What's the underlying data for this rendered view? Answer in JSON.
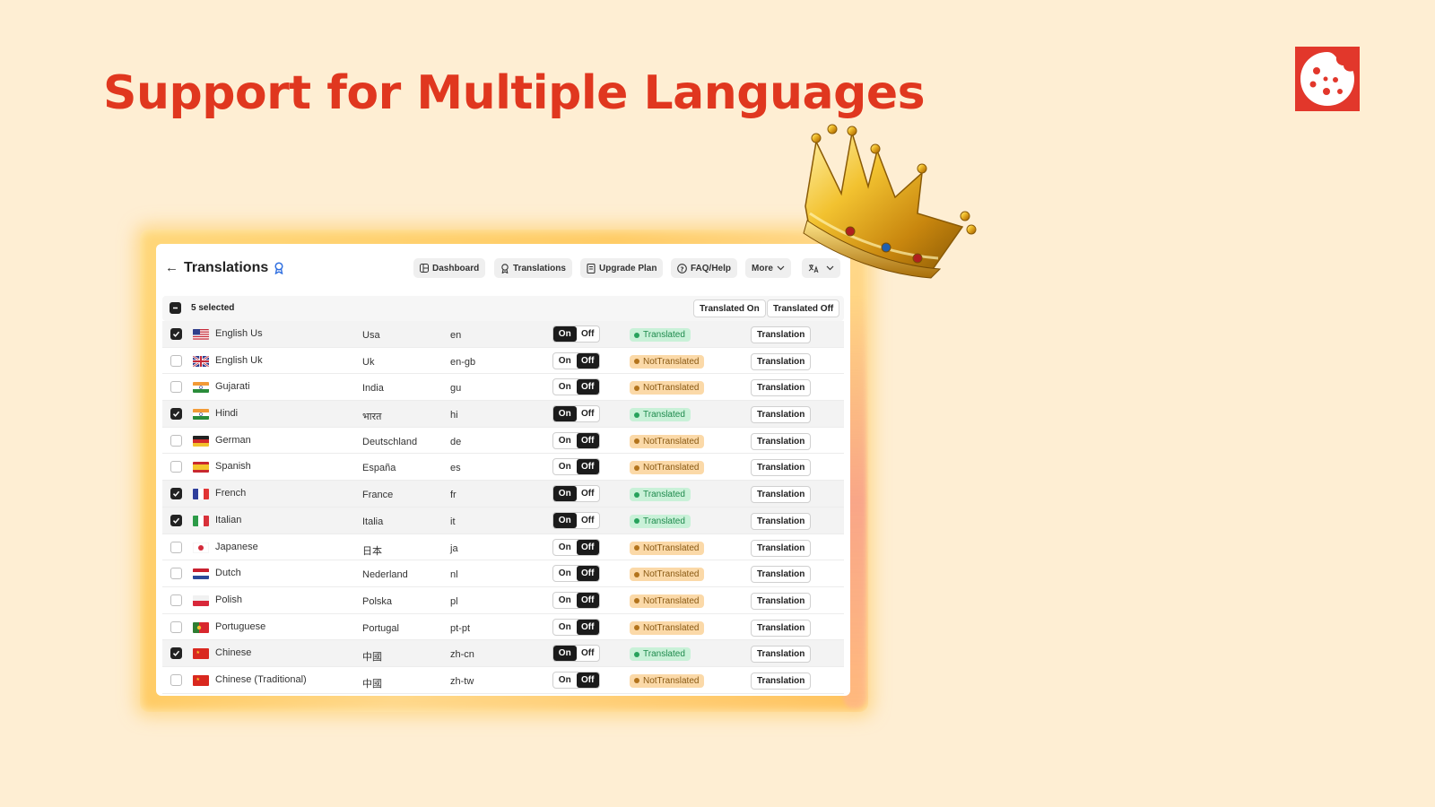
{
  "headline": "Support for Multiple Languages",
  "brand_logo": "cookie-logo",
  "decoration": "gold-crown",
  "header": {
    "back_icon": "arrow-left-icon",
    "title": "Translations",
    "title_icon": "award-badge-icon"
  },
  "nav": [
    {
      "label": "Dashboard",
      "icon": "layout-icon"
    },
    {
      "label": "Translations",
      "icon": "award-icon"
    },
    {
      "label": "Upgrade Plan",
      "icon": "receipt-icon"
    },
    {
      "label": "FAQ/Help",
      "icon": "help-circle-icon"
    },
    {
      "label": "More",
      "icon": "chevron-down-icon"
    }
  ],
  "language_switcher_icon": "translate-icon",
  "selection": {
    "text": "5 selected",
    "bulk_on": "Translated On",
    "bulk_off": "Translated Off"
  },
  "colors": {
    "background": "#feeed3",
    "headline": "#e0371f",
    "logo": "#e2372b",
    "translated_bg": "#c9f1d8",
    "not_translated_bg": "#fbd9a8"
  },
  "toggle_labels": {
    "on": "On",
    "off": "Off"
  },
  "action_label": "Translation",
  "rows": [
    {
      "name": "English Us",
      "country": "Usa",
      "code": "en",
      "flag": "us",
      "checked": true,
      "toggle": "On",
      "status": "Translated"
    },
    {
      "name": "English Uk",
      "country": "Uk",
      "code": "en-gb",
      "flag": "uk",
      "checked": false,
      "toggle": "Off",
      "status": "NotTranslated"
    },
    {
      "name": "Gujarati",
      "country": "India",
      "code": "gu",
      "flag": "in",
      "checked": false,
      "toggle": "Off",
      "status": "NotTranslated"
    },
    {
      "name": "Hindi",
      "country": "भारत",
      "code": "hi",
      "flag": "in",
      "checked": true,
      "toggle": "On",
      "status": "Translated"
    },
    {
      "name": "German",
      "country": "Deutschland",
      "code": "de",
      "flag": "de",
      "checked": false,
      "toggle": "Off",
      "status": "NotTranslated"
    },
    {
      "name": "Spanish",
      "country": "España",
      "code": "es",
      "flag": "es",
      "checked": false,
      "toggle": "Off",
      "status": "NotTranslated"
    },
    {
      "name": "French",
      "country": "France",
      "code": "fr",
      "flag": "fr",
      "checked": true,
      "toggle": "On",
      "status": "Translated"
    },
    {
      "name": "Italian",
      "country": "Italia",
      "code": "it",
      "flag": "it",
      "checked": true,
      "toggle": "On",
      "status": "Translated"
    },
    {
      "name": "Japanese",
      "country": "日本",
      "code": "ja",
      "flag": "jp",
      "checked": false,
      "toggle": "Off",
      "status": "NotTranslated"
    },
    {
      "name": "Dutch",
      "country": "Nederland",
      "code": "nl",
      "flag": "nl",
      "checked": false,
      "toggle": "Off",
      "status": "NotTranslated"
    },
    {
      "name": "Polish",
      "country": "Polska",
      "code": "pl",
      "flag": "pl",
      "checked": false,
      "toggle": "Off",
      "status": "NotTranslated"
    },
    {
      "name": "Portuguese",
      "country": "Portugal",
      "code": "pt-pt",
      "flag": "pt",
      "checked": false,
      "toggle": "Off",
      "status": "NotTranslated"
    },
    {
      "name": "Chinese",
      "country": "中國",
      "code": "zh-cn",
      "flag": "cn",
      "checked": true,
      "toggle": "On",
      "status": "Translated"
    },
    {
      "name": "Chinese (Traditional)",
      "country": "中國",
      "code": "zh-tw",
      "flag": "cn",
      "checked": false,
      "toggle": "Off",
      "status": "NotTranslated"
    }
  ]
}
